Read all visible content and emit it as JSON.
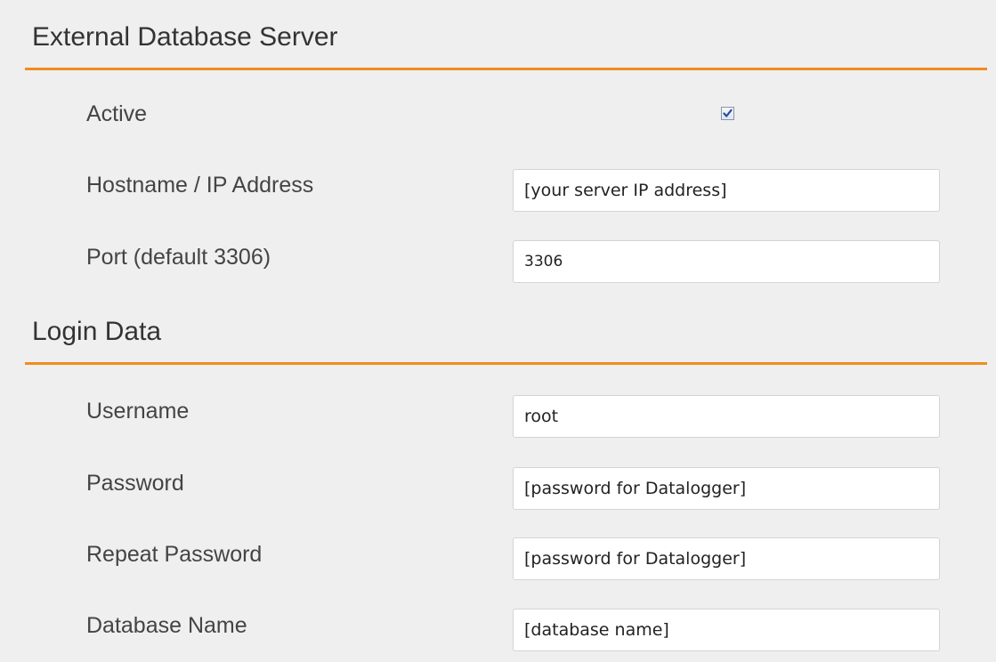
{
  "external_server": {
    "title": "External Database Server",
    "active_label": "Active",
    "active_checked": true,
    "hostname_label": "Hostname / IP Address",
    "hostname_value": "[your server IP address]",
    "port_label": "Port (default 3306)",
    "port_value": "3306"
  },
  "login": {
    "title": "Login Data",
    "username_label": "Username",
    "username_value": "root",
    "password_label": "Password",
    "password_value": "[password for Datalogger]",
    "repeat_password_label": "Repeat Password",
    "repeat_password_value": "[password for Datalogger]",
    "database_name_label": "Database Name",
    "database_name_value": "[database name]"
  },
  "icons": {
    "checkbox_mark": "checkmark-icon"
  },
  "colors": {
    "accent": "#f08c1e",
    "background": "#efefef",
    "field_background": "#ffffff",
    "checkmark": "#2b4e99"
  }
}
